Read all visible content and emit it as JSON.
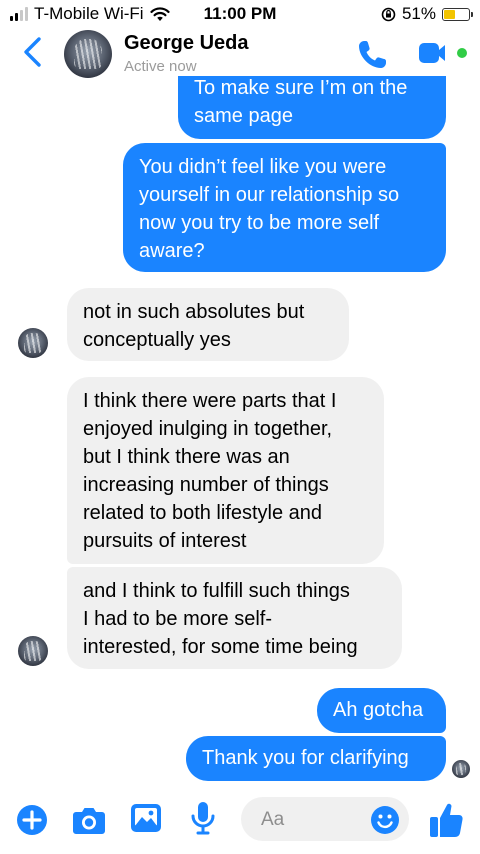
{
  "status_bar": {
    "carrier": "T-Mobile Wi-Fi",
    "time": "11:00 PM",
    "battery_percent": "51%",
    "battery_level": 0.51,
    "battery_color": "#f2c400"
  },
  "header": {
    "contact_name": "George Ueda",
    "contact_status": "Active now",
    "accent_color": "#1a84ff",
    "active_color": "#31cc46"
  },
  "messages": [
    {
      "sender": "me",
      "lines": [
        "To make sure I’m on the",
        "same page"
      ]
    },
    {
      "sender": "me",
      "lines": [
        "You didn’t feel like you were",
        "yourself in our relationship so",
        "now you try to be more self",
        "aware?"
      ]
    },
    {
      "sender": "them",
      "lines": [
        "not in such absolutes but",
        "conceptually yes"
      ]
    },
    {
      "sender": "them",
      "lines": [
        "I think there were parts that I",
        "enjoyed inulging in together,",
        "but I think there was an",
        "increasing number of things",
        "related to both lifestyle and",
        "pursuits of interest"
      ]
    },
    {
      "sender": "them",
      "lines": [
        "and I think to fulfill such things",
        "I had to be more self-",
        "interested, for some time being"
      ]
    },
    {
      "sender": "me",
      "lines": [
        "Ah gotcha"
      ]
    },
    {
      "sender": "me",
      "lines": [
        "Thank you for clarifying"
      ]
    }
  ],
  "composer": {
    "placeholder": "Aa",
    "icons": [
      "plus-icon",
      "camera-icon",
      "image-icon",
      "microphone-icon",
      "emoji-icon",
      "thumbs-up-icon"
    ]
  }
}
